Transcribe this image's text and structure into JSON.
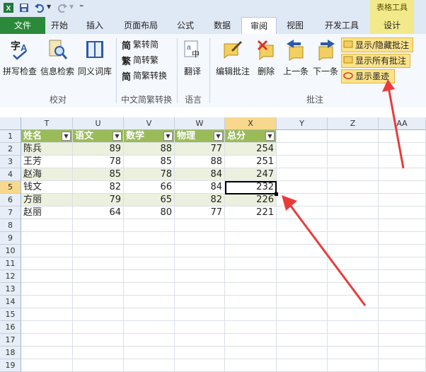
{
  "quick_access": {
    "app_icon": "excel-icon",
    "save_icon": "save-icon",
    "undo_icon": "undo-icon",
    "redo_icon": "redo-icon",
    "customize_icon": "customize-qat-icon"
  },
  "context_tab_group": "表格工具",
  "tabs": [
    {
      "label": "文件"
    },
    {
      "label": "开始"
    },
    {
      "label": "插入"
    },
    {
      "label": "页面布局"
    },
    {
      "label": "公式"
    },
    {
      "label": "数据"
    },
    {
      "label": "审阅"
    },
    {
      "label": "视图"
    },
    {
      "label": "开发工具"
    },
    {
      "label": "设计"
    }
  ],
  "ribbon": {
    "proofing": {
      "buttons": [
        "拼写检查",
        "信息检索",
        "同义词库"
      ],
      "group_label": "校对"
    },
    "chinese_conversion": {
      "items": [
        "繁转简",
        "简转繁",
        "简繁转换"
      ],
      "group_label": "中文简繁转换"
    },
    "language": {
      "buttons": [
        "翻译"
      ],
      "group_label": "语言"
    },
    "comments": {
      "buttons": [
        "编辑批注",
        "删除",
        "上一条",
        "下一条"
      ],
      "small_buttons": [
        "显示/隐藏批注",
        "显示所有批注",
        "显示墨迹"
      ],
      "group_label": "批注"
    }
  },
  "sheet": {
    "columns": [
      "T",
      "U",
      "V",
      "W",
      "X",
      "Y",
      "Z",
      "AA"
    ],
    "rows": [
      "1",
      "2",
      "3",
      "4",
      "5",
      "6",
      "7",
      "8",
      "9",
      "10",
      "11",
      "12",
      "13",
      "14",
      "15",
      "16",
      "17",
      "18",
      "19"
    ],
    "table_headers": [
      "姓名",
      "语文",
      "数学",
      "物理",
      "总分"
    ],
    "table_rows": [
      [
        "陈兵",
        "89",
        "88",
        "77",
        "254"
      ],
      [
        "王芳",
        "78",
        "85",
        "88",
        "251"
      ],
      [
        "赵海",
        "85",
        "78",
        "84",
        "247"
      ],
      [
        "钱文",
        "82",
        "66",
        "84",
        "232"
      ],
      [
        "方丽",
        "79",
        "65",
        "82",
        "226"
      ],
      [
        "赵丽",
        "64",
        "80",
        "77",
        "221"
      ]
    ],
    "selected_cell": "X5",
    "header_color": "#9bbb59",
    "band_color": "#ebf1de"
  },
  "annotation_color": "#ea3b3b"
}
